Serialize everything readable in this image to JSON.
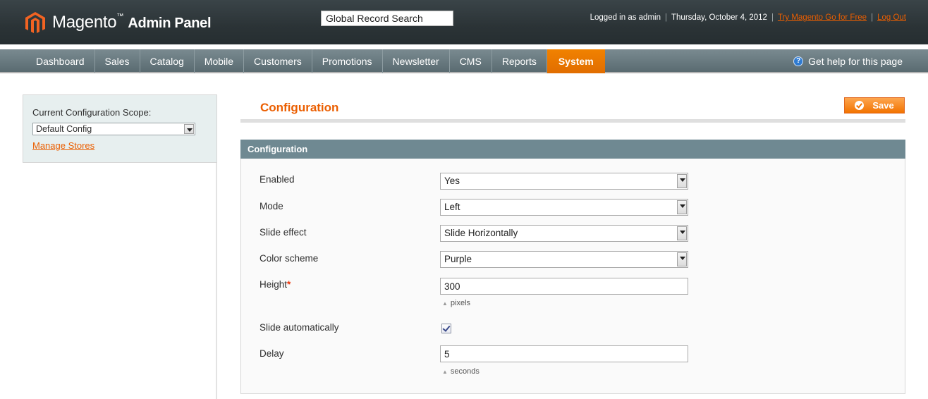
{
  "header": {
    "logo_brand": "Magento",
    "logo_tm": "™",
    "logo_suffix": "Admin Panel",
    "search_value": "Global Record Search",
    "logged_in": "Logged in as admin",
    "date": "Thursday, October 4, 2012",
    "try_link": "Try Magento Go for Free",
    "logout_link": "Log Out"
  },
  "nav": {
    "items": [
      "Dashboard",
      "Sales",
      "Catalog",
      "Mobile",
      "Customers",
      "Promotions",
      "Newsletter",
      "CMS",
      "Reports",
      "System"
    ],
    "active": "System",
    "help": "Get help for this page"
  },
  "sidebar": {
    "scope_label": "Current Configuration Scope:",
    "scope_value": "Default Config",
    "manage_stores": "Manage Stores"
  },
  "main": {
    "page_title": "Configuration",
    "save_label": "Save",
    "section_title": "Configuration",
    "fields": {
      "enabled": {
        "label": "Enabled",
        "value": "Yes"
      },
      "mode": {
        "label": "Mode",
        "value": "Left"
      },
      "slide_effect": {
        "label": "Slide effect",
        "value": "Slide Horizontally"
      },
      "color_scheme": {
        "label": "Color scheme",
        "value": "Purple"
      },
      "height": {
        "label": "Height",
        "required_mark": "*",
        "value": "300",
        "note": "pixels"
      },
      "slide_auto": {
        "label": "Slide automatically",
        "checked": true
      },
      "delay": {
        "label": "Delay",
        "value": "5",
        "note": "seconds"
      }
    }
  },
  "colors": {
    "accent": "#eb5e00",
    "header_bg": "#2b3336",
    "nav_bg": "#6a7b81",
    "section_header": "#6f8992",
    "sidebar_bg": "#e7efef"
  }
}
